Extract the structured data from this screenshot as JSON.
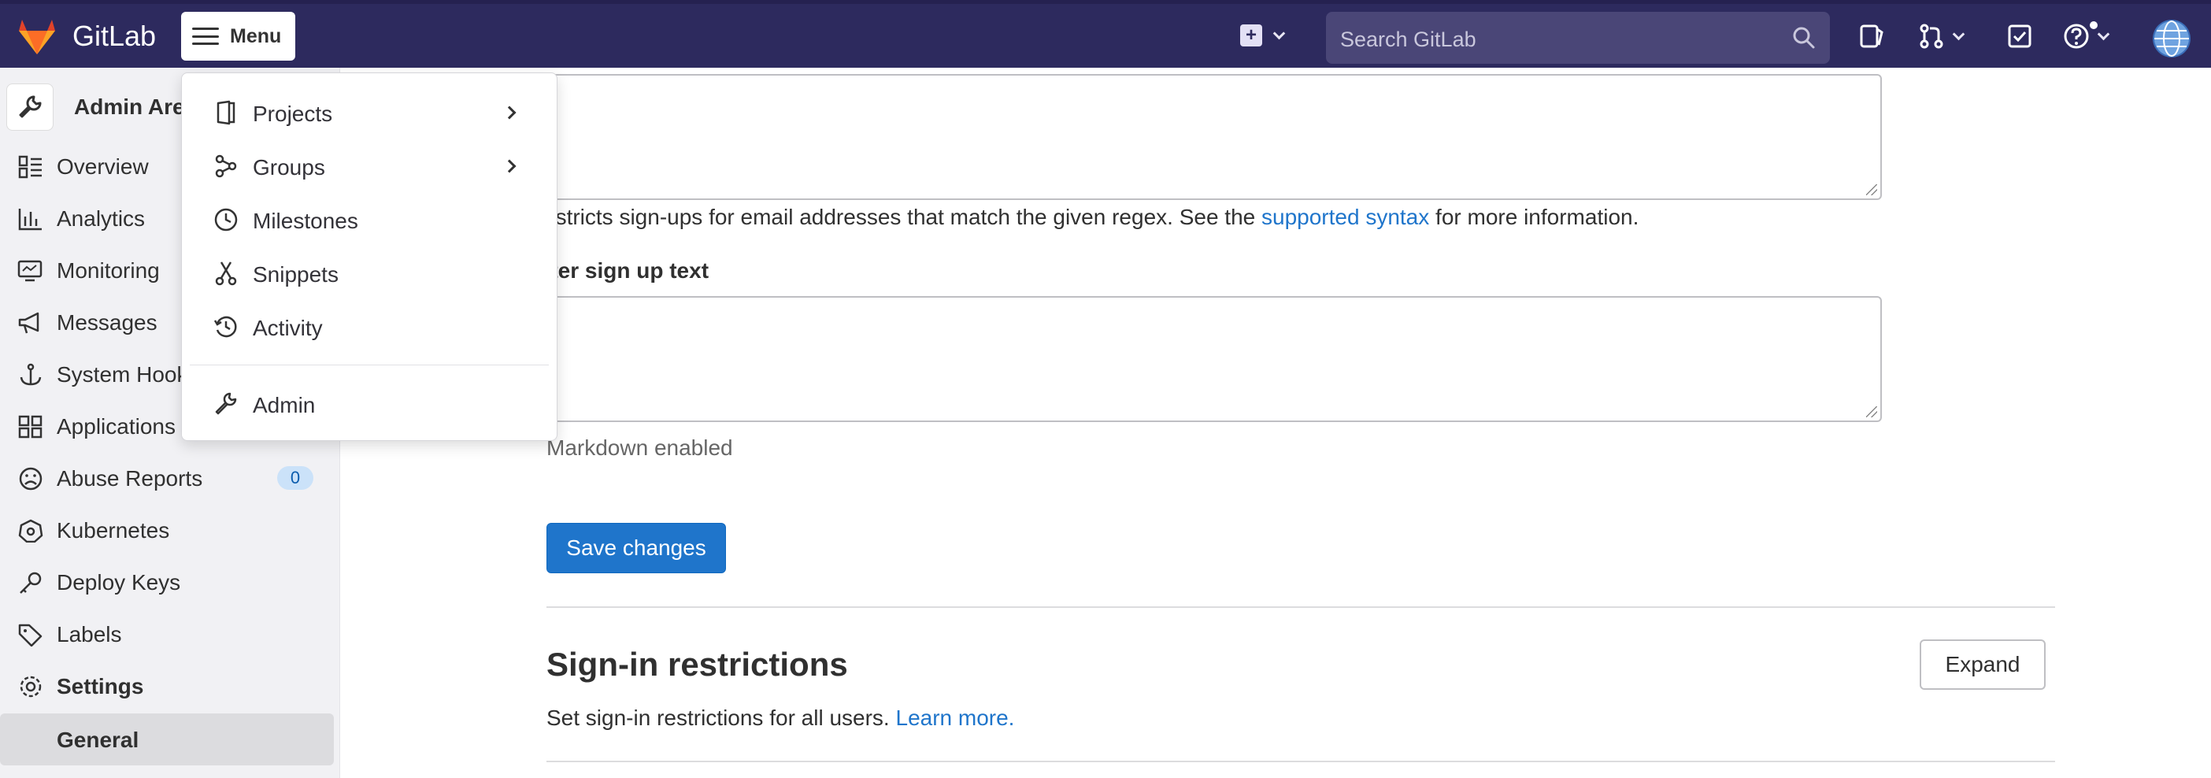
{
  "topbar": {
    "brand": "GitLab",
    "menu_label": "Menu",
    "search_placeholder": "Search GitLab"
  },
  "sidebar": {
    "context_title": "Admin Area",
    "items": [
      {
        "label": "Overview",
        "icon": "overview-icon"
      },
      {
        "label": "Analytics",
        "icon": "chart-icon"
      },
      {
        "label": "Monitoring",
        "icon": "monitor-icon"
      },
      {
        "label": "Messages",
        "icon": "bullhorn-icon"
      },
      {
        "label": "System Hooks",
        "icon": "anchor-icon"
      },
      {
        "label": "Applications",
        "icon": "applications-icon"
      },
      {
        "label": "Abuse Reports",
        "icon": "sad-face-icon",
        "badge": "0"
      },
      {
        "label": "Kubernetes",
        "icon": "kubernetes-icon"
      },
      {
        "label": "Deploy Keys",
        "icon": "key-icon"
      },
      {
        "label": "Labels",
        "icon": "label-icon"
      },
      {
        "label": "Settings",
        "icon": "settings-icon"
      },
      {
        "label": "General"
      }
    ]
  },
  "dropdown": {
    "items": [
      {
        "label": "Projects",
        "icon": "project-icon",
        "has_submenu": true
      },
      {
        "label": "Groups",
        "icon": "group-icon",
        "has_submenu": true
      },
      {
        "label": "Milestones",
        "icon": "clock-icon"
      },
      {
        "label": "Snippets",
        "icon": "snippet-icon"
      },
      {
        "label": "Activity",
        "icon": "history-icon"
      },
      {
        "label": "Admin",
        "icon": "admin-icon"
      }
    ]
  },
  "main": {
    "regex_help_prefix": "estricts sign-ups for email addresses that match the given regex. See the ",
    "regex_help_link": "supported syntax",
    "regex_help_suffix": " for more information.",
    "after_signup_label": "fter sign up text",
    "markdown_note": "Markdown enabled",
    "save_button": "Save changes",
    "section_title": "Sign-in restrictions",
    "expand_button": "Expand",
    "section_desc_prefix": "Set sign-in restrictions for all users. ",
    "section_desc_link": "Learn more."
  },
  "colors": {
    "navbar": "#2d2a5e",
    "primary": "#1f75cb",
    "link": "#1f75cb",
    "sidebar_bg": "#f1f1f4",
    "badge_bg": "#cbe2f9"
  }
}
